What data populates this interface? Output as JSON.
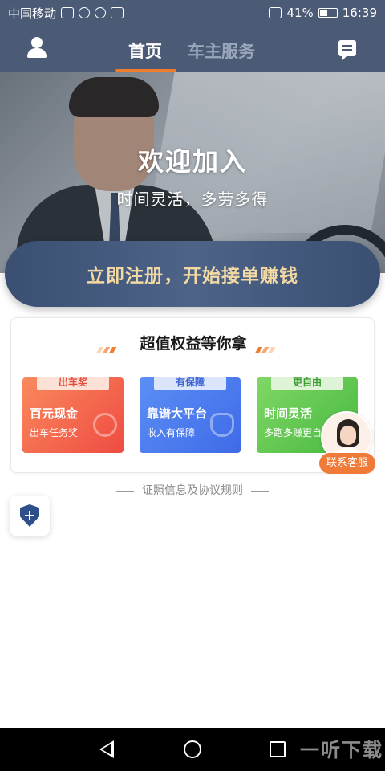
{
  "status_bar": {
    "carrier": "中国移动",
    "battery": "41%",
    "time": "16:39"
  },
  "nav": {
    "tabs": [
      {
        "label": "首页",
        "active": true
      },
      {
        "label": "车主服务",
        "active": false
      }
    ]
  },
  "hero": {
    "title": "欢迎加入",
    "subtitle": "时间灵活，多劳多得"
  },
  "register": {
    "label": "立即注册，开始接单赚钱"
  },
  "benefits": {
    "title": "超值权益等你拿",
    "cards": [
      {
        "badge": "出车奖",
        "title": "百元现金",
        "subtitle": "出车任务奖",
        "color": "#ef4b42"
      },
      {
        "badge": "有保障",
        "title": "靠谱大平台",
        "subtitle": "收入有保障",
        "color": "#3f6ae8"
      },
      {
        "badge": "更自由",
        "title": "时间灵活",
        "subtitle": "多跑多赚更自",
        "color": "#47b93f"
      }
    ]
  },
  "customer_service": {
    "label": "联系客服"
  },
  "license_link": {
    "label": "证照信息及协议规则"
  },
  "watermark": "一听下载",
  "colors": {
    "nav_bg": "#4b5b75",
    "accent": "#f07c2e",
    "register_text": "#f2d9a3"
  }
}
